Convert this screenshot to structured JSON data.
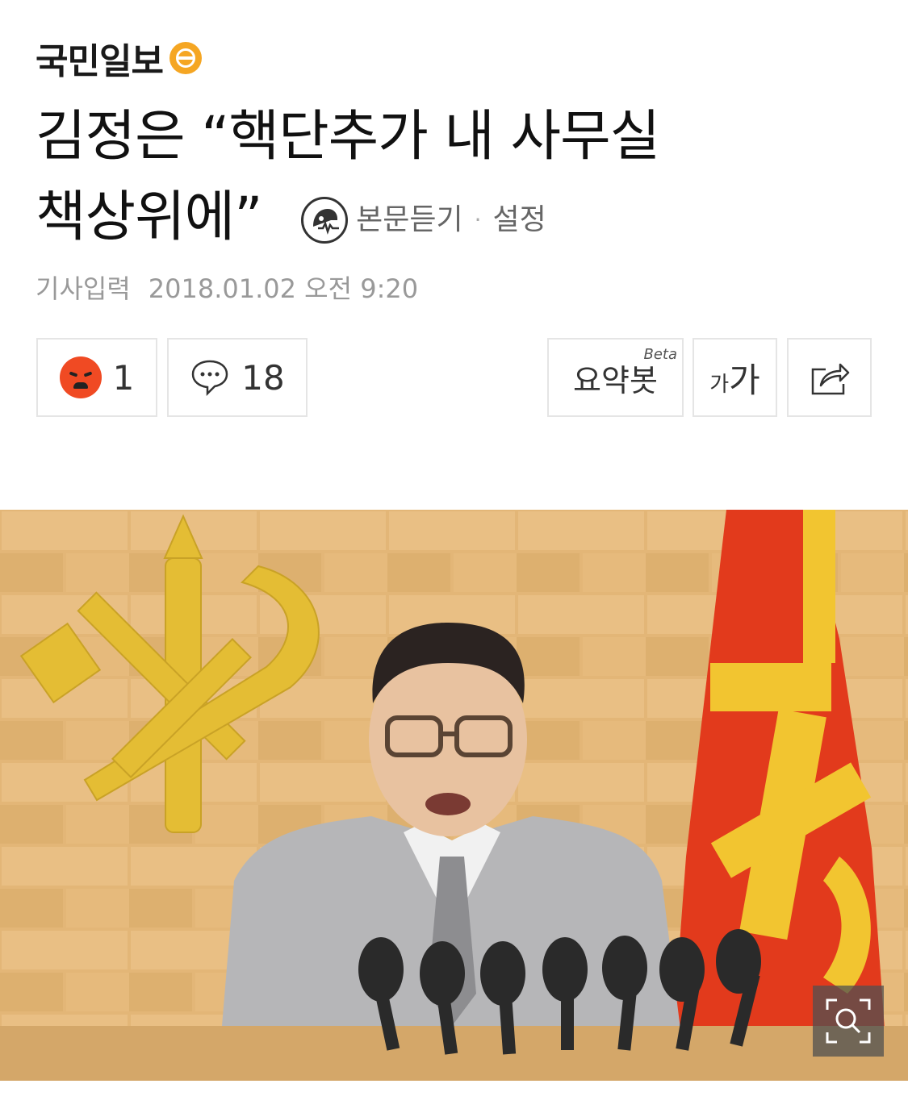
{
  "header": {
    "logo_text": "국민일보"
  },
  "article": {
    "headline_line1": "김정은 “핵단추가 내 사무실",
    "headline_line2": "책상위에”",
    "listen_label": "본문듣기",
    "settings_label": "설정",
    "meta_label": "기사입력",
    "meta_datetime": "2018.01.02 오전 9:20"
  },
  "toolbar": {
    "reaction_count": "1",
    "comment_count": "18",
    "summary_label": "요약봇",
    "summary_badge": "Beta",
    "font_small": "가",
    "font_large": "가"
  },
  "colors": {
    "brand": "#f5a623",
    "angry": "#f04a23",
    "flag_red": "#e23a1c",
    "emblem_gold": "#e9c23a"
  },
  "icons": [
    "logo-mark-icon",
    "listen-icon",
    "angry-reaction-icon",
    "comment-icon",
    "share-icon",
    "zoom-icon"
  ]
}
